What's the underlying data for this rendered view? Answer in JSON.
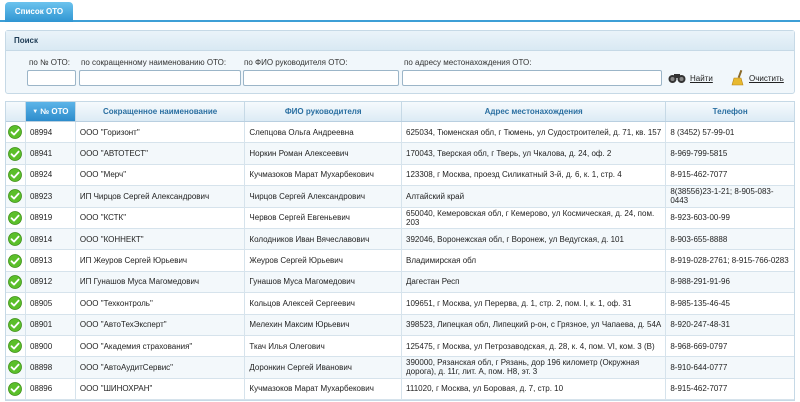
{
  "tab": {
    "label": "Список ОТО"
  },
  "search": {
    "title": "Поиск",
    "fields": [
      {
        "label": "по № ОТО:",
        "value": ""
      },
      {
        "label": "по сокращенному наименованию ОТО:",
        "value": ""
      },
      {
        "label": "по ФИО руководителя ОТО:",
        "value": ""
      },
      {
        "label": "по адресу местонахождения ОТО:",
        "value": ""
      }
    ],
    "find_label": "Найти",
    "clear_label": "Очистить"
  },
  "table": {
    "columns": [
      "№ ОТО",
      "Сокращенное наименование",
      "ФИО руководителя",
      "Адрес местонахождения",
      "Телефон"
    ],
    "sort_indicator": "▼",
    "status_color": "#5bbf2a",
    "rows": [
      {
        "num": "08994",
        "name": "ООО \"Горизонт\"",
        "head": "Слепцова Ольга Андреевна",
        "address": "625034, Тюменская обл, г Тюмень, ул Судостроителей, д. 71, кв. 157",
        "phone": "8 (3452) 57-99-01"
      },
      {
        "num": "08941",
        "name": "ООО \"АВТОТЕСТ\"",
        "head": "Норкин Роман Алексеевич",
        "address": "170043, Тверская обл, г Тверь, ул Чкалова, д. 24, оф. 2",
        "phone": "8-969-799-5815"
      },
      {
        "num": "08924",
        "name": "ООО \"Мерч\"",
        "head": "Кучмазоков Марат Мухарбекович",
        "address": "123308, г Москва, проезд Силикатный 3-й, д. 6, к. 1, стр. 4",
        "phone": "8-915-462-7077"
      },
      {
        "num": "08923",
        "name": "ИП Чирцов Сергей Александрович",
        "head": "Чирцов Сергей Александрович",
        "address": "Алтайский край",
        "phone": "8(38556)23-1-21; 8-905-083-0443"
      },
      {
        "num": "08919",
        "name": "ООО \"КСТК\"",
        "head": "Червов Сергей Евгеньевич",
        "address": "650040, Кемеровская обл, г Кемерово, ул Космическая, д. 24, пом. 203",
        "phone": "8-923-603-00-99"
      },
      {
        "num": "08914",
        "name": "ООО \"КОННЕКТ\"",
        "head": "Колодников Иван Вячеславович",
        "address": "392046, Воронежская обл, г Воронеж, ул Ведугская, д. 101",
        "phone": "8-903-655-8888"
      },
      {
        "num": "08913",
        "name": "ИП Жеуров Сергей Юрьевич",
        "head": "Жеуров Сергей Юрьевич",
        "address": "Владимирская обл",
        "phone": "8-919-028-2761; 8-915-766-0283"
      },
      {
        "num": "08912",
        "name": "ИП Гунашов Муса Магомедович",
        "head": "Гунашов Муса Магомедович",
        "address": "Дагестан Респ",
        "phone": "8-988-291-91-96"
      },
      {
        "num": "08905",
        "name": "ООО \"Техконтроль\"",
        "head": "Кольцов Алексей Сергеевич",
        "address": "109651, г Москва, ул Перерва, д. 1, стр. 2, пом. I, к. 1, оф. 31",
        "phone": "8-985-135-46-45"
      },
      {
        "num": "08901",
        "name": "ООО \"АвтоТехЭксперт\"",
        "head": "Мелехин Максим Юрьевич",
        "address": "398523, Липецкая обл, Липецкий р-он, с Грязное, ул Чапаева, д. 54А",
        "phone": "8-920-247-48-31"
      },
      {
        "num": "08900",
        "name": "ООО \"Академия страхования\"",
        "head": "Ткач Илья Олегович",
        "address": "125475, г Москва, ул Петрозаводская, д. 28, к. 4, пом. VI, ком. 3 (В)",
        "phone": "8-968-669-0797"
      },
      {
        "num": "08898",
        "name": "ООО \"АвтоАудитСервис\"",
        "head": "Доронкин Сергей Иванович",
        "address": "390000, Рязанская обл, г Рязань, дор 196 километр (Окружная дорога), д. 11г, лит. А, пом. Н8, эт. 3",
        "phone": "8-910-644-0777"
      },
      {
        "num": "08896",
        "name": "ООО \"ШИНОХРАН\"",
        "head": "Кучмазоков Марат Мухарбекович",
        "address": "111020, г Москва, ул Боровая, д. 7, стр. 10",
        "phone": "8-915-462-7077"
      }
    ]
  }
}
